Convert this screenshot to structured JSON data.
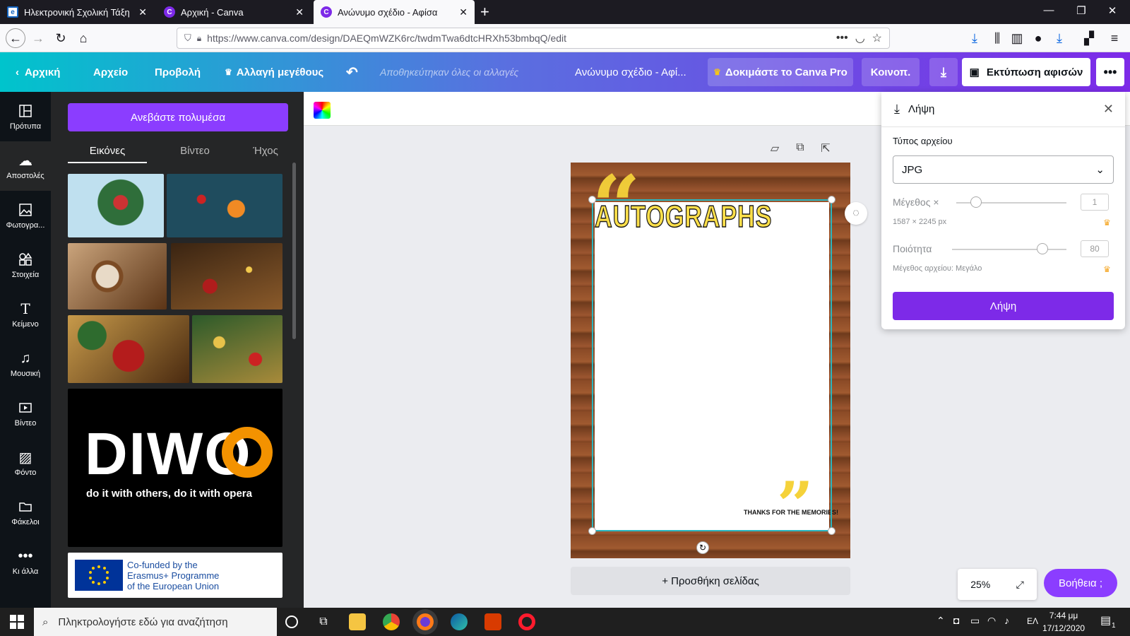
{
  "browser": {
    "tabs": [
      {
        "label": "Ηλεκτρονική Σχολική Τάξη (η-Τ",
        "active": false
      },
      {
        "label": "Αρχική - Canva",
        "active": false
      },
      {
        "label": "Ανώνυμο σχέδιο - Αφίσα",
        "active": true
      }
    ],
    "url": "https://www.canva.com/design/DAEQmWZK6rc/twdmTwa6dtcHRXh53bmbqQ/edit"
  },
  "header": {
    "home": "Αρχική",
    "file": "Αρχείο",
    "view": "Προβολή",
    "resize": "Αλλαγή μεγέθους",
    "saved_status": "Αποθηκεύτηκαν όλες οι αλλαγές",
    "doc_title": "Ανώνυμο σχέδιο - Αφί...",
    "try_pro": "Δοκιμάστε το Canva Pro",
    "share": "Κοινοπ.",
    "print": "Εκτύπωση αφισών"
  },
  "rail": [
    {
      "label": "Πρότυπα",
      "icon": "layout-icon"
    },
    {
      "label": "Αποστολές",
      "icon": "upload-cloud-icon",
      "active": true
    },
    {
      "label": "Φωτογρα...",
      "icon": "photo-icon"
    },
    {
      "label": "Στοιχεία",
      "icon": "elements-icon"
    },
    {
      "label": "Κείμενο",
      "icon": "text-icon"
    },
    {
      "label": "Μουσική",
      "icon": "music-icon"
    },
    {
      "label": "Βίντεο",
      "icon": "video-icon"
    },
    {
      "label": "Φόντο",
      "icon": "background-icon"
    },
    {
      "label": "Φάκελοι",
      "icon": "folder-icon"
    },
    {
      "label": "Κι άλλα",
      "icon": "more-icon"
    }
  ],
  "panel": {
    "upload_button": "Ανεβάστε πολυμέσα",
    "tabs": [
      "Εικόνες",
      "Βίντεο",
      "Ήχος"
    ],
    "diwo_title": "DIWO",
    "diwo_subtitle": "do it with others, do it with opera",
    "eu_line1": "Co-funded by the",
    "eu_line2": "Erasmus+ Programme",
    "eu_line3": "of the European Union"
  },
  "design": {
    "heading": "AUTOGRAPHS",
    "footer": "THANKS FOR THE MEMORIES!",
    "add_page": "+ Προσθήκη σελίδας"
  },
  "download": {
    "title": "Λήψη",
    "file_type_label": "Τύπος αρχείου",
    "file_type": "JPG",
    "size_label": "Μέγεθος ×",
    "size_value": "1",
    "dimensions": "1587 × 2245 px",
    "quality_label": "Ποιότητα",
    "quality_value": "80",
    "file_size": "Μέγεθος αρχείου: Μεγάλο",
    "button": "Λήψη"
  },
  "zoom": "25%",
  "help": "Βοήθεια ;",
  "taskbar": {
    "search_placeholder": "Πληκτρολογήστε εδώ για αναζήτηση",
    "lang": "ΕΛ",
    "time": "7:44 μμ",
    "date": "17/12/2020",
    "notifications": "1"
  },
  "colors": {
    "accent": "#7d2ae8",
    "header_start": "#00c4cc",
    "rail_bg": "#0e1318",
    "panel_bg": "#252627"
  }
}
